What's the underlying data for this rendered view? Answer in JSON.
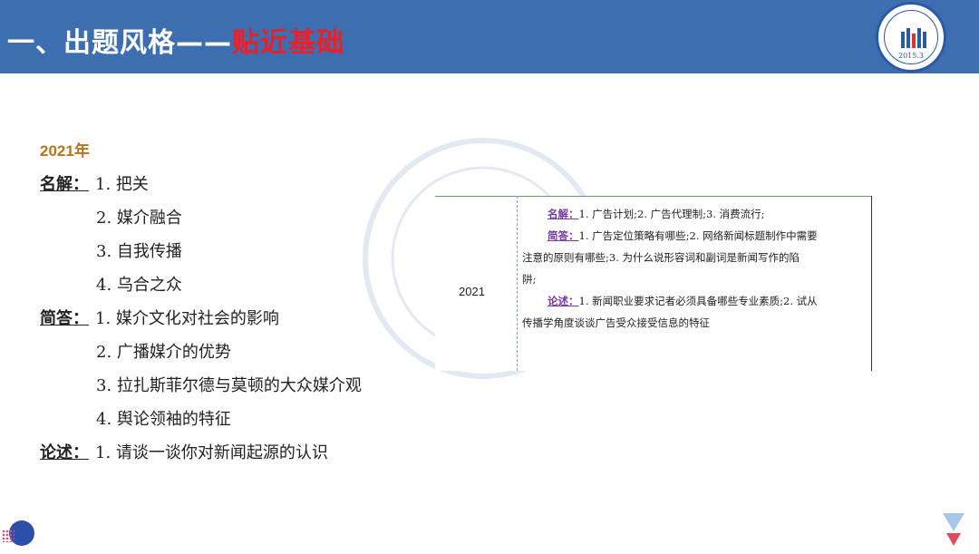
{
  "header": {
    "title_prefix": "一、出题风格——",
    "title_accent": "贴近基础",
    "logo_year": "2015.3"
  },
  "content": {
    "year": "2021年",
    "sections": [
      {
        "category": "名解：",
        "items": [
          "1. 把关",
          "2. 媒介融合",
          "3. 自我传播",
          "4. 乌合之众"
        ]
      },
      {
        "category": "简答：",
        "items": [
          "1. 媒介文化对社会的影响",
          "2. 广播媒介的优势",
          "3. 拉扎斯菲尔德与莫顿的大众媒介观",
          "4. 舆论领袖的特征"
        ]
      },
      {
        "category": "论述：",
        "items": [
          "1. 请谈一谈你对新闻起源的认识"
        ]
      }
    ]
  },
  "table_image": {
    "year": "2021",
    "lines": [
      {
        "label": "名解：",
        "text": "1. 广告计划;2. 广告代理制;3. 消费流行;"
      },
      {
        "label": "简答：",
        "text": "1. 广告定位策略有哪些;2. 网络新闻标题制作中需要"
      },
      {
        "label": "",
        "text": "注意的原则有哪些;3. 为什么说形容词和副词是新闻写作的陷"
      },
      {
        "label": "",
        "text": "阱;"
      },
      {
        "label": "论述：",
        "text": "1. 新闻职业要求记者必须具备哪些专业素质;2. 试从"
      },
      {
        "label": "",
        "text": "传播学角度谈谈广告受众接受信息的特征"
      }
    ]
  },
  "colors": {
    "header_bg": "#3d6fb0",
    "accent": "#e8202a",
    "year_label": "#b8731c",
    "table_label": "#7a3aa0"
  }
}
